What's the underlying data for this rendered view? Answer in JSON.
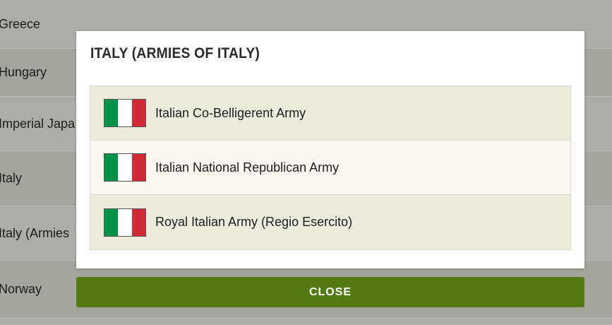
{
  "background_list": {
    "items": [
      {
        "label": "Greece"
      },
      {
        "label": "Hungary"
      },
      {
        "label": "Imperial Japa"
      },
      {
        "label": "Italy"
      },
      {
        "label": "Italy (Armies"
      },
      {
        "label": "Norway"
      }
    ]
  },
  "modal": {
    "title": "ITALY (ARMIES OF ITALY)",
    "armies": [
      {
        "label": "Italian Co-Belligerent Army",
        "flag_icon": "italy-flag-icon"
      },
      {
        "label": "Italian National Republican Army",
        "flag_icon": "italy-flag-icon"
      },
      {
        "label": "Royal Italian Army (Regio Esercito)",
        "flag_icon": "italy-flag-icon"
      }
    ],
    "close_label": "CLOSE"
  },
  "colors": {
    "flag_green": "#009246",
    "flag_white": "#ffffff",
    "flag_red": "#ce2b37",
    "close_button": "#547a15",
    "row_odd": "#ebecdc",
    "row_even": "#fcf9f1"
  }
}
